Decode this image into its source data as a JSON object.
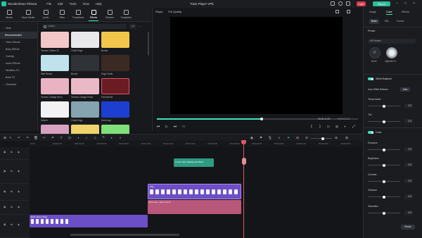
{
  "app": {
    "name": "Wondershare Filmora",
    "menu": [
      "File",
      "Edit",
      "Tools",
      "View",
      "Help"
    ],
    "project": "Track Player VPE",
    "login": "Login",
    "export": "Export"
  },
  "media_tabs": [
    "Media",
    "Stock Media",
    "Audio",
    "Titles",
    "Transitions",
    "Effects",
    "Stickers",
    "Templates"
  ],
  "categories": [
    "Mine",
    "Recommended",
    "Video Effects",
    "Body Effects",
    "Overlay",
    "Audio Effects",
    "NewBlue FX",
    "Boris FX",
    "Character"
  ],
  "search": {
    "value": "outline",
    "filter": "All"
  },
  "effects": [
    {
      "label": "Texture Outline St",
      "bg": "#f3c7c7"
    },
    {
      "label": "Chalk Edge",
      "bg": "#e8e8ea"
    },
    {
      "label": "Border",
      "bg": "#f1c64a"
    },
    {
      "label": "Wall Stroke",
      "bg": "#bfe2ec"
    },
    {
      "label": "Border",
      "bg": "#2f3338"
    },
    {
      "label": "Edge Scale",
      "bg": "#3b2a24"
    },
    {
      "label": "Texture Collage Neon",
      "bg": "#e9b3c3"
    },
    {
      "label": "Texture Collage Picad",
      "bg": "#e9b9c7"
    },
    {
      "label": "Fire Behind",
      "bg": "#6a1c22"
    },
    {
      "label": "Sketch",
      "bg": "#f2f2f4"
    },
    {
      "label": "Chalk Edge",
      "bg": "#86a4b0"
    },
    {
      "label": "Heat map",
      "bg": "#1d3fd1"
    },
    {
      "label": "",
      "bg": "#d9a1c0"
    },
    {
      "label": "",
      "bg": "#f0d36a"
    },
    {
      "label": "",
      "bg": "#7fe07a"
    }
  ],
  "player": {
    "label": "Player",
    "quality": "Full Quality",
    "current_time": "00:00:11:23",
    "total_time": "00:00:22:07",
    "progress": 0.52
  },
  "right_panel": {
    "tabs": [
      "Image",
      "Color",
      "Effects"
    ],
    "active_tab": "Color",
    "subtabs": [
      "Basic",
      "HSL",
      "Curves"
    ],
    "preset_label": "Preset",
    "preset_filter": "All Presets",
    "presets": [
      {
        "label": "None"
      },
      {
        "label": "Vignette 01"
      }
    ],
    "white_balance": "White Balance",
    "auto_wb": "Auto White Balance",
    "auto_btn": "Auto",
    "temperature": {
      "label": "Temperature",
      "value": "0.0"
    },
    "tint": {
      "label": "Tint",
      "value": "0.0"
    },
    "color_section": "Color",
    "exposure": {
      "label": "Exposure",
      "value": "0.0"
    },
    "brightness": {
      "label": "Brightness",
      "value": "0.0"
    },
    "contrast": {
      "label": "Contrast",
      "value": "0.0"
    },
    "vibrance": {
      "label": "Vibrance",
      "value": "0.0"
    },
    "saturation": {
      "label": "Saturation",
      "value": "0.0"
    },
    "reset": "Reset"
  },
  "timeline": {
    "ruler": [
      "00:00",
      "00:00:02:00",
      "00:00:04:00",
      "00:00:06:00",
      "00:00:08:00",
      "00:00:10:00",
      "00:00:12:00",
      "00:00:14:00",
      "00:00:16:00",
      "00:00:18:00",
      "00:00:20:00",
      "00:00:22:00",
      "00:00:24:00",
      "00:00:26:00",
      "00:00:28:00"
    ],
    "clips": {
      "title_clip": "Comic Style Background Bubl...",
      "video_clip": "Play",
      "audio_clip": "Run now - Now I Am In",
      "bottom_clip": "Brain Demo Playl"
    }
  },
  "colors": {
    "accent": "#3ee0c0",
    "playhead": "#e05567",
    "video_clip": "#6c4fc6",
    "audio_clip": "#b8577a",
    "title_clip": "#2e9c82"
  }
}
